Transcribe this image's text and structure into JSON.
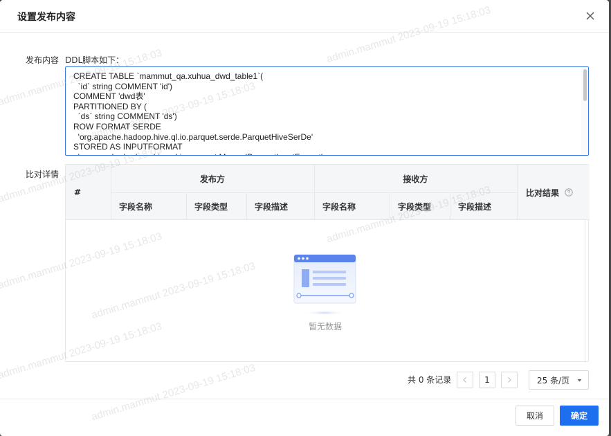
{
  "modal": {
    "title": "设置发布内容"
  },
  "publish": {
    "label": "发布内容",
    "caption": "DDL脚本如下：",
    "ddl": "CREATE TABLE `mammut_qa.xuhua_dwd_table1`(\n  `id` string COMMENT 'id')\nCOMMENT 'dwd表'\nPARTITIONED BY (\n  `ds` string COMMENT 'ds')\nROW FORMAT SERDE\n  'org.apache.hadoop.hive.ql.io.parquet.serde.ParquetHiveSerDe'\nSTORED AS INPUTFORMAT\n  'org.apache.hadoop.hive.ql.io.parquet.MapredParquetInputFormat'"
  },
  "compare": {
    "label": "比对详情",
    "headers": {
      "index": "#",
      "publisher": "发布方",
      "receiver": "接收方",
      "result": "比对结果"
    },
    "sub_headers": [
      "字段名称",
      "字段类型",
      "字段描述",
      "字段名称",
      "字段类型",
      "字段描述"
    ],
    "rows": [],
    "empty_text": "暂无数据"
  },
  "pagination": {
    "total_text": "共 0 条记录",
    "current_page": "1",
    "page_size": "25 条/页"
  },
  "footer": {
    "cancel_label": "取消",
    "ok_label": "确定"
  },
  "watermark": "admin.mammut 2023-09-19 15:18:03",
  "colors": {
    "primary": "#1e6ff0",
    "focus_border": "#3b7ddd",
    "header_bg": "#f5f6f8"
  }
}
